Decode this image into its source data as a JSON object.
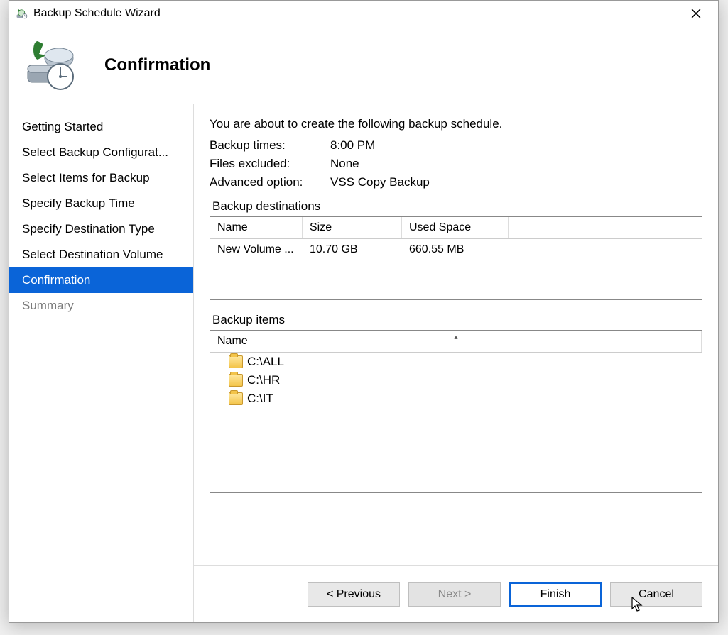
{
  "window": {
    "title": "Backup Schedule Wizard"
  },
  "header": {
    "heading": "Confirmation"
  },
  "sidebar": {
    "steps": [
      {
        "label": "Getting Started",
        "state": "done"
      },
      {
        "label": "Select Backup Configurat...",
        "state": "done"
      },
      {
        "label": "Select Items for Backup",
        "state": "done"
      },
      {
        "label": "Specify Backup Time",
        "state": "done"
      },
      {
        "label": "Specify Destination Type",
        "state": "done"
      },
      {
        "label": "Select Destination Volume",
        "state": "done"
      },
      {
        "label": "Confirmation",
        "state": "active"
      },
      {
        "label": "Summary",
        "state": "disabled"
      }
    ]
  },
  "content": {
    "intro": "You are about to create the following backup schedule.",
    "details": {
      "backup_times_label": "Backup times:",
      "backup_times_value": "8:00 PM",
      "files_excluded_label": "Files excluded:",
      "files_excluded_value": "None",
      "advanced_option_label": "Advanced option:",
      "advanced_option_value": "VSS Copy Backup"
    },
    "destinations": {
      "section_label": "Backup destinations",
      "columns": {
        "name": "Name",
        "size": "Size",
        "used": "Used Space"
      },
      "rows": [
        {
          "name": "New Volume ...",
          "size": "10.70 GB",
          "used": "660.55 MB"
        }
      ]
    },
    "items": {
      "section_label": "Backup items",
      "columns": {
        "name": "Name"
      },
      "rows": [
        {
          "path": "C:\\ALL"
        },
        {
          "path": "C:\\HR"
        },
        {
          "path": "C:\\IT"
        }
      ]
    }
  },
  "footer": {
    "previous": "< Previous",
    "next": "Next >",
    "finish": "Finish",
    "cancel": "Cancel"
  }
}
